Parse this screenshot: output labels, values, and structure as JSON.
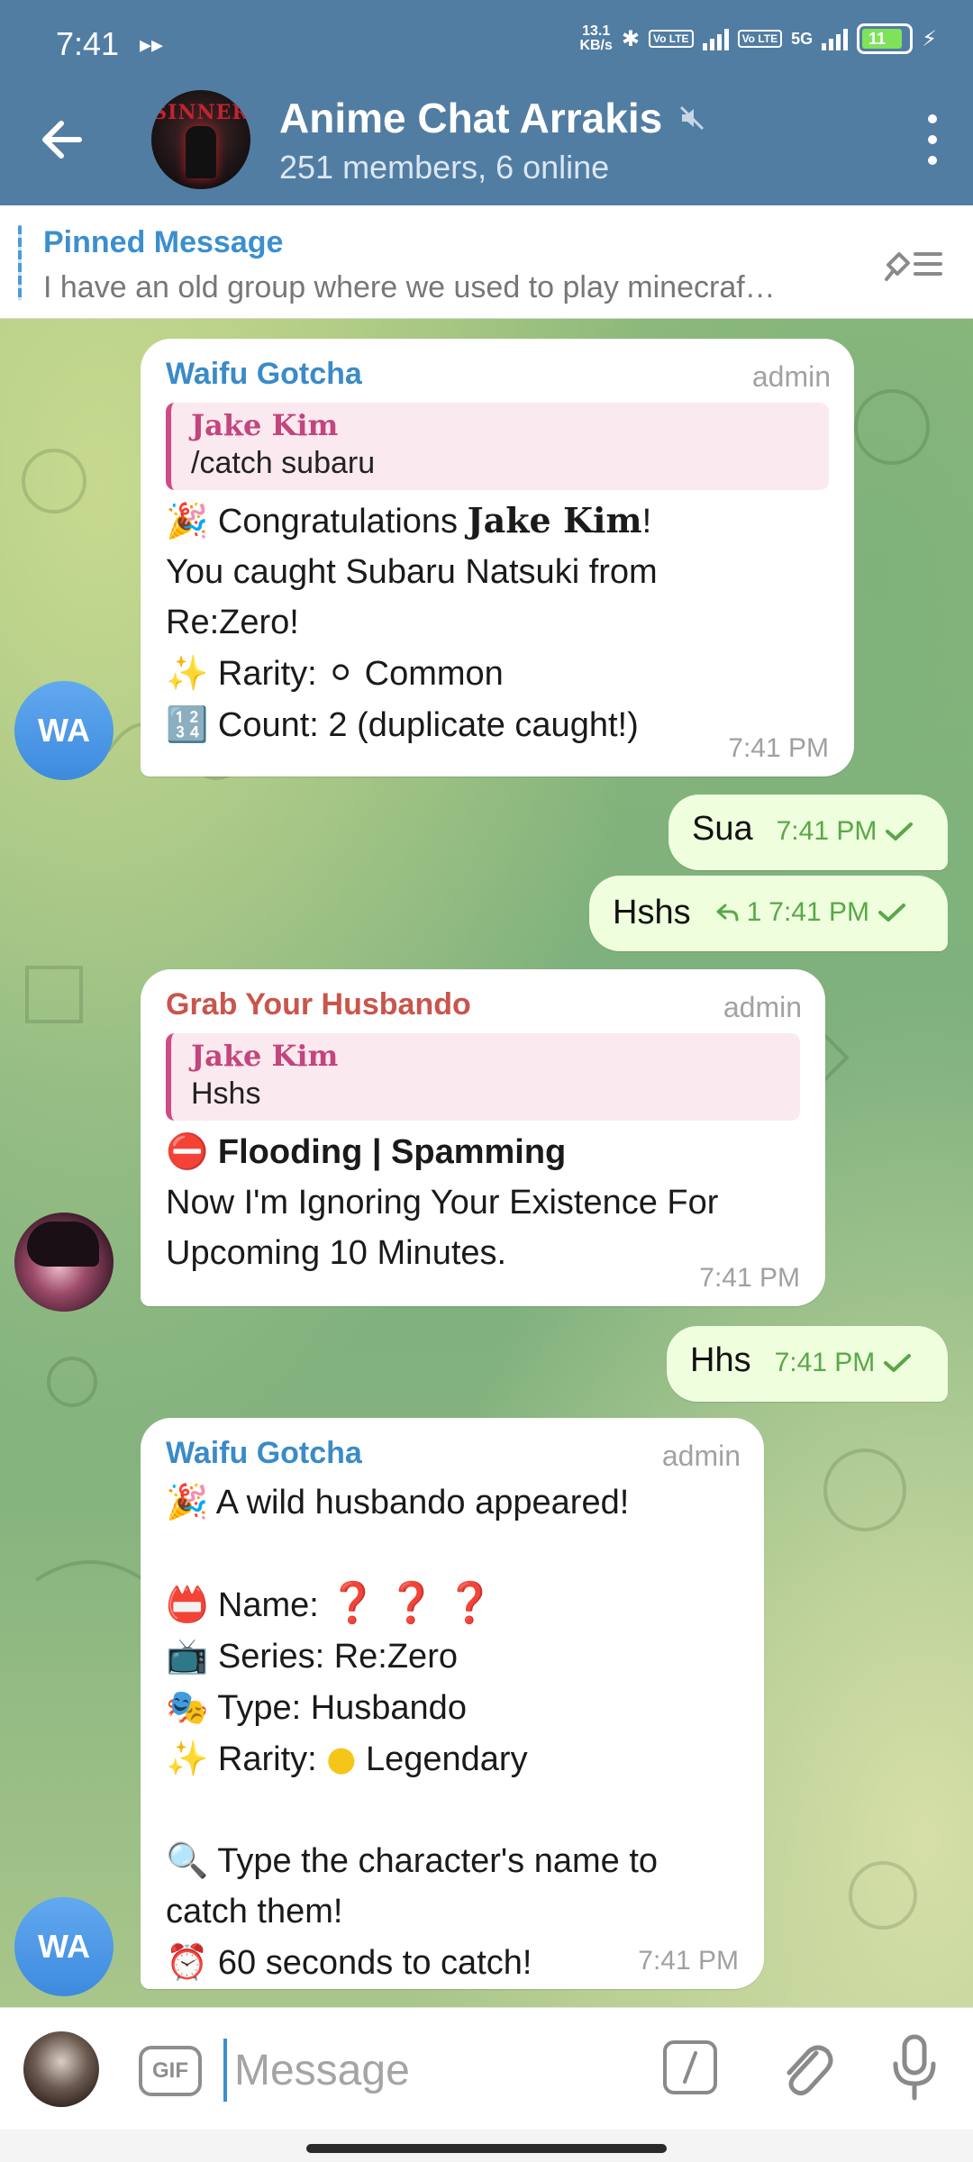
{
  "status_bar": {
    "time": "7:41",
    "net_speed_value": "13.1",
    "net_speed_unit": "KB/s",
    "volte_label": "Vo LTE",
    "network_5g": "5G",
    "battery_level": "11"
  },
  "header": {
    "title": "Anime Chat Arrakis",
    "subtitle": "251 members, 6 online",
    "avatar_text": "SINNER",
    "muted": true
  },
  "pinned": {
    "title": "Pinned Message",
    "text": "I have an old group where we used to play minecraf…"
  },
  "messages": [
    {
      "sender": "Waifu Gotcha",
      "admin_label": "admin",
      "reply_name": "Jake Kim",
      "reply_text": "/catch subaru",
      "line1_pre": "Congratulations ",
      "line1_name": "Jake Kim",
      "line1_post": "!",
      "line2": "You caught Subaru Natsuki from",
      "line3": "Re:Zero!",
      "line4": "Rarity: ",
      "line4_value": "Common",
      "line5": "Count: 2 (duplicate caught!)",
      "time": "7:41 PM",
      "avatar": "WA"
    },
    {
      "text": "Sua",
      "time": "7:41 PM"
    },
    {
      "text": "Hshs",
      "replies": "1",
      "time": "7:41 PM"
    },
    {
      "sender": "Grab Your Husbando",
      "admin_label": "admin",
      "reply_name": "Jake Kim",
      "reply_text": "Hshs",
      "headline": "Flooding | Spamming",
      "line2": "Now I'm Ignoring Your Existence For",
      "line3": "Upcoming 10 Minutes.",
      "time": "7:41 PM"
    },
    {
      "text": "Hhs",
      "time": "7:41 PM"
    },
    {
      "sender": "Waifu Gotcha",
      "admin_label": "admin",
      "line1": "A wild husbando appeared!",
      "name_label": "Name: ",
      "name_value": "❓❓❓",
      "series": "Series: Re:Zero",
      "type": "Type: Husbando",
      "rarity_label": "Rarity: ",
      "rarity_value": "Legendary",
      "hint1": "Type the character's name to",
      "hint2": "catch them!",
      "timer": "60 seconds to catch!",
      "time": "7:41 PM",
      "avatar": "WA"
    }
  ],
  "input": {
    "gif_label": "GIF",
    "placeholder": "Message"
  },
  "colors": {
    "header_bg": "#527da3",
    "accent_blue": "#3a8bc8",
    "sender_red": "#c9554c",
    "reply_pink": "#cf4b85",
    "outgoing_bg": "#effedd",
    "check_green": "#5aa74a"
  },
  "icons": [
    "back-arrow-icon",
    "mute-icon",
    "more-vertical-icon",
    "pinned-list-icon",
    "check-icon",
    "reply-arrow-icon",
    "command-icon",
    "paperclip-icon",
    "microphone-icon"
  ]
}
